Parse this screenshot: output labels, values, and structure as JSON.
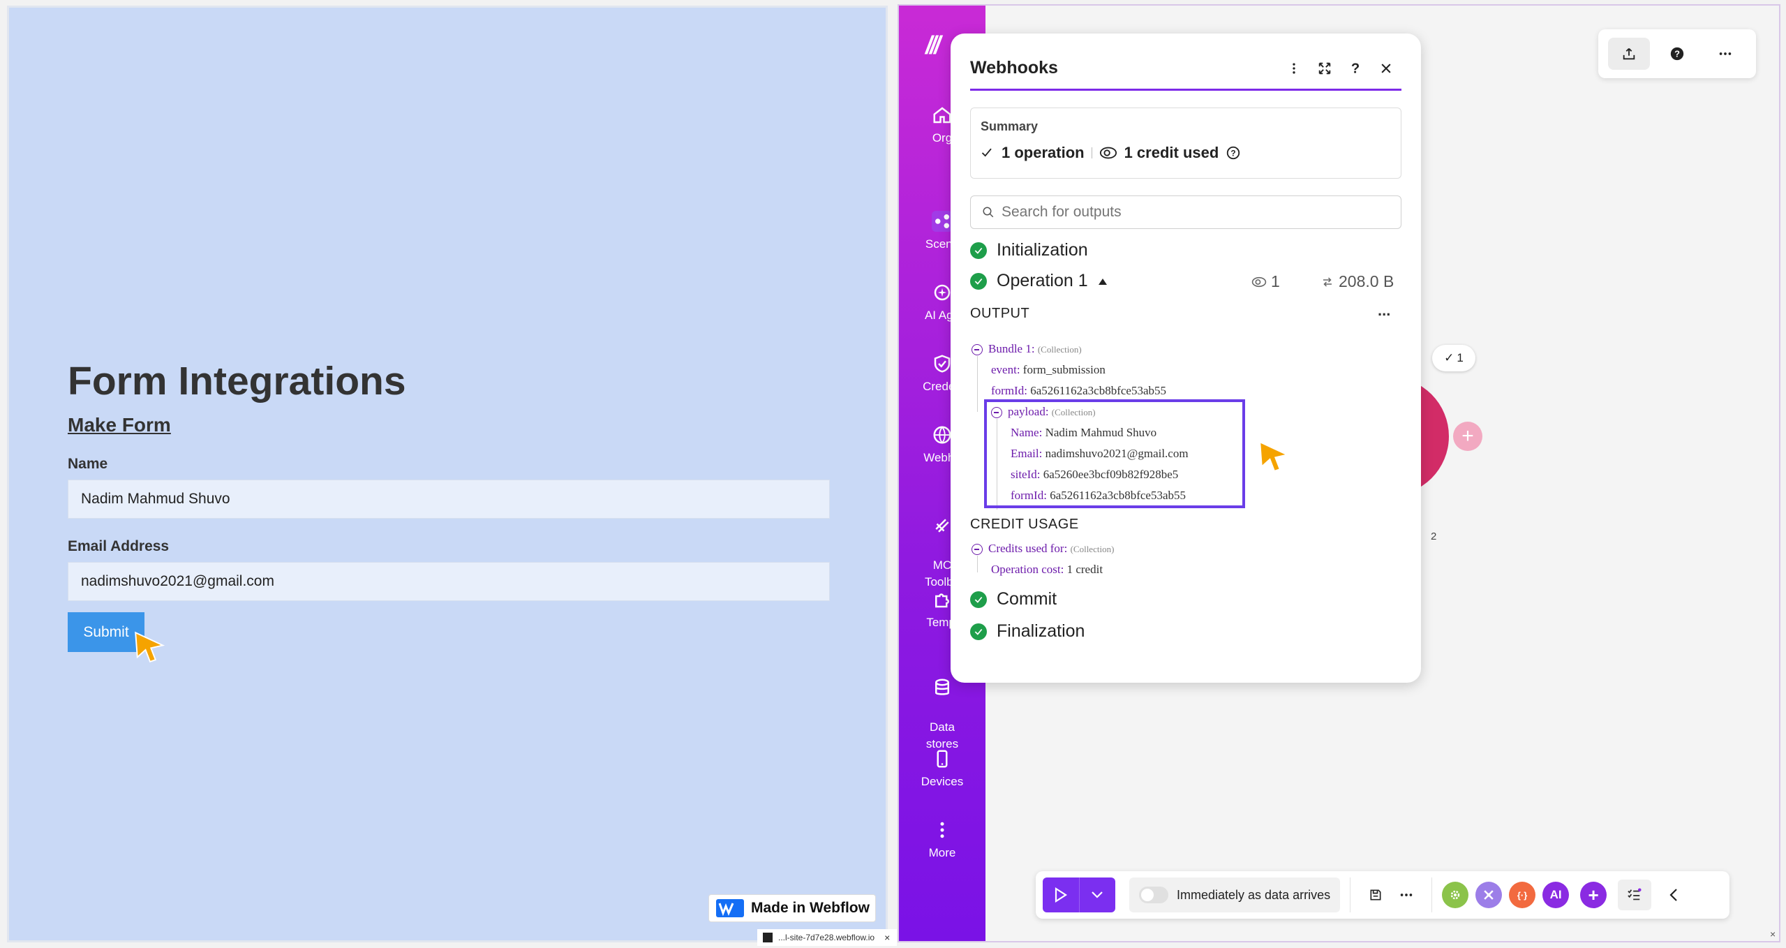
{
  "form": {
    "title": "Form Integrations",
    "subtitle": "Make Form",
    "name_label": "Name",
    "name_value": "Nadim Mahmud Shuvo",
    "email_label": "Email Address",
    "email_value": "nadimshuvo2021@gmail.com",
    "submit_label": "Submit"
  },
  "webflow": {
    "badge": "Made in Webflow",
    "url": "...l-site-7d7e28.webflow.io",
    "close": "×"
  },
  "nav": {
    "items": [
      {
        "label": "Org",
        "icon": "home-icon"
      },
      {
        "label": "Scena",
        "icon": "share-icon"
      },
      {
        "label": "AI Age",
        "icon": "ai-icon"
      },
      {
        "label": "Creden",
        "icon": "shield-icon"
      },
      {
        "label": "Webho",
        "icon": "globe-icon"
      },
      {
        "label": "MC\nToolbo",
        "icon": "toolbox-icon"
      },
      {
        "label": "Templ",
        "icon": "puzzle-icon"
      },
      {
        "label": "Data\nstores",
        "icon": "database-icon"
      },
      {
        "label": "Devices",
        "icon": "device-icon"
      },
      {
        "label": "More",
        "icon": "more-vertical-icon"
      }
    ]
  },
  "panel": {
    "title": "Webhooks",
    "summary_label": "Summary",
    "operations": "1 operation",
    "credits": "1 credit used",
    "search_placeholder": "Search for outputs",
    "step_init": "Initialization",
    "step_op": "Operation 1",
    "op_count": "1",
    "op_size": "208.0 B",
    "output_title": "OUTPUT",
    "output_more": "...",
    "bundle_key": "Bundle 1:",
    "bundle_type": "(Collection)",
    "event_key": "event:",
    "event_val": "form_submission",
    "formid_key": "formId:",
    "formid_val": "6a5261162a3cb8bfce53ab55",
    "payload_key": "payload:",
    "payload_type": "(Collection)",
    "p_name_key": "Name:",
    "p_name_val": "Nadim Mahmud Shuvo",
    "p_email_key": "Email:",
    "p_email_val": "nadimshuvo2021@gmail.com",
    "p_siteid_key": "siteId:",
    "p_siteid_val": "6a5260ee3bcf09b82f928be5",
    "p_formid_key": "formId:",
    "p_formid_val": "6a5261162a3cb8bfce53ab55",
    "credit_title": "CREDIT USAGE",
    "credits_key": "Credits used for:",
    "credits_type": "(Collection)",
    "cost_key": "Operation cost:",
    "cost_val": "1 credit",
    "step_commit": "Commit",
    "step_final": "Finalization"
  },
  "canvas": {
    "bubble_count": "1",
    "node_number": "2"
  },
  "toolbar": {
    "schedule_label": "Immediately as data arrives"
  },
  "colors": {
    "accent": "#7b2ff0",
    "success": "#1e9e4a",
    "sidebar_top": "#c92ad6",
    "sidebar_bottom": "#7a12e6",
    "form_bg": "#c9d9f6",
    "submit": "#3b95e9",
    "node": "#d22c67"
  }
}
